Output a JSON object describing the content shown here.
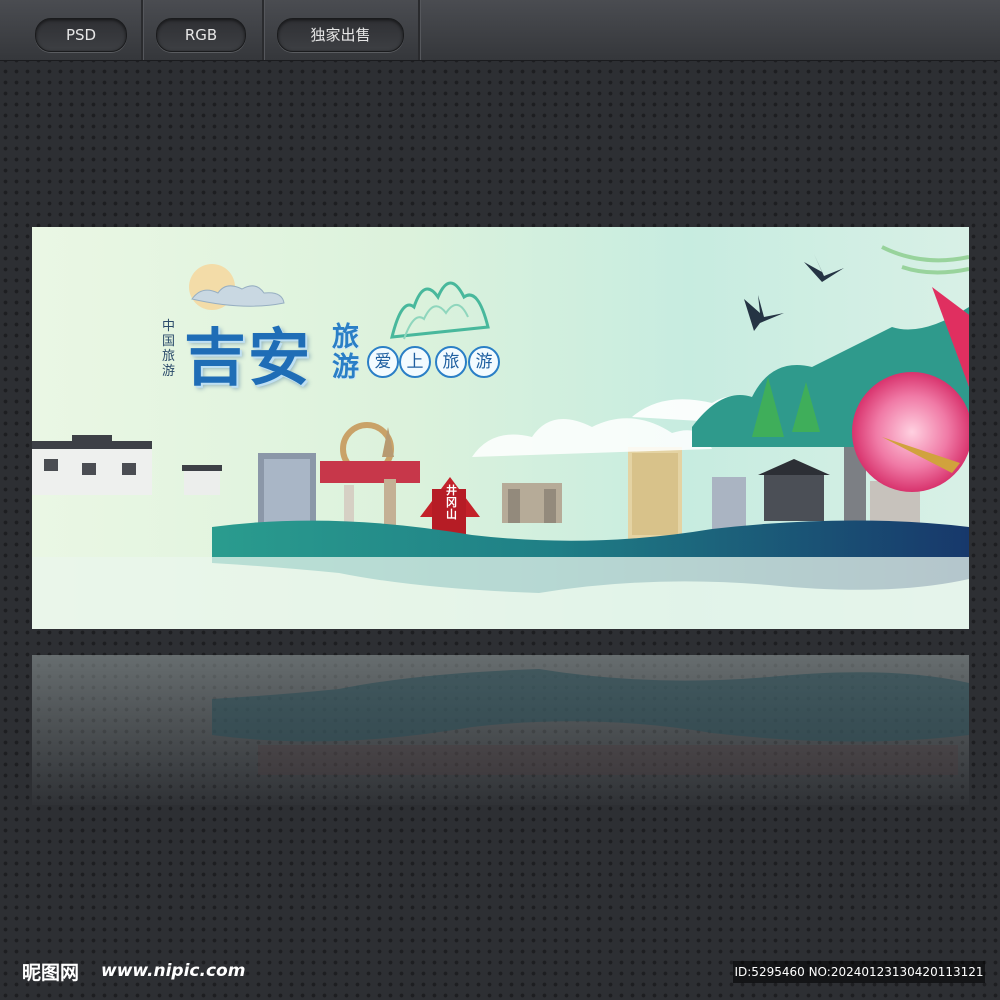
{
  "toolbar": {
    "format_label": "PSD",
    "color_label": "RGB",
    "exclusive_label": "独家出售"
  },
  "banner": {
    "vertical_label": "中国旅游",
    "title_main": "吉安",
    "title_small_1": "旅",
    "title_small_2": "游",
    "slogan_chars": [
      "爱",
      "上",
      "旅",
      "游"
    ],
    "gate_sign": "井冈山"
  },
  "footer": {
    "logo_text": "昵图网",
    "logo_url": "www.nipic.com",
    "image_id": "ID:5295460 NO:20240123130420113121"
  },
  "colors": {
    "title_blue": "#1f6db6",
    "ink_teal": "#1f7f86",
    "ink_navy": "#17386b",
    "flower_pink": "#e8407a"
  }
}
